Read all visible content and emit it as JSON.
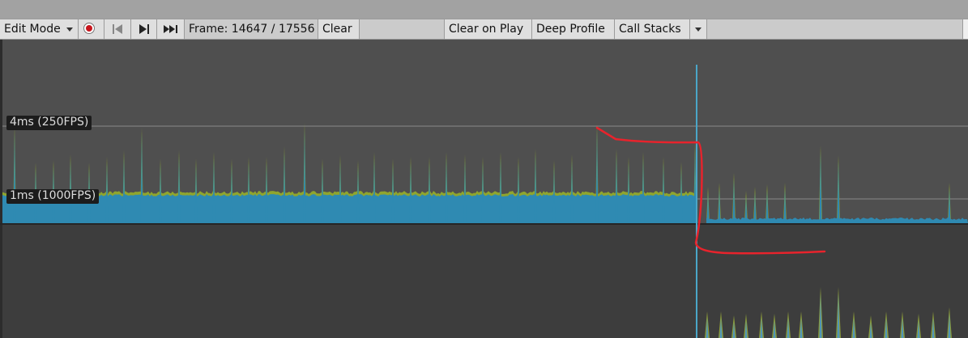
{
  "toolbar": {
    "mode_label": "Edit Mode",
    "frame_label": "Frame: 14647 / 17556",
    "clear_label": "Clear",
    "clear_on_play_label": "Clear on Play",
    "deep_profile_label": "Deep Profile",
    "call_stacks_label": "Call Stacks",
    "icons": [
      "chevron-down-icon",
      "record-icon",
      "step-back-icon",
      "step-forward-icon",
      "skip-to-end-icon"
    ]
  },
  "graph": {
    "label_4ms": "4ms (250FPS)",
    "label_1ms": "1ms (1000FPS)"
  },
  "colors": {
    "cpu_blue": "#2f8ab2",
    "cpu_yellow": "#8fa52e",
    "annotation_red": "#e8232c",
    "record_red": "#c8161d"
  }
}
